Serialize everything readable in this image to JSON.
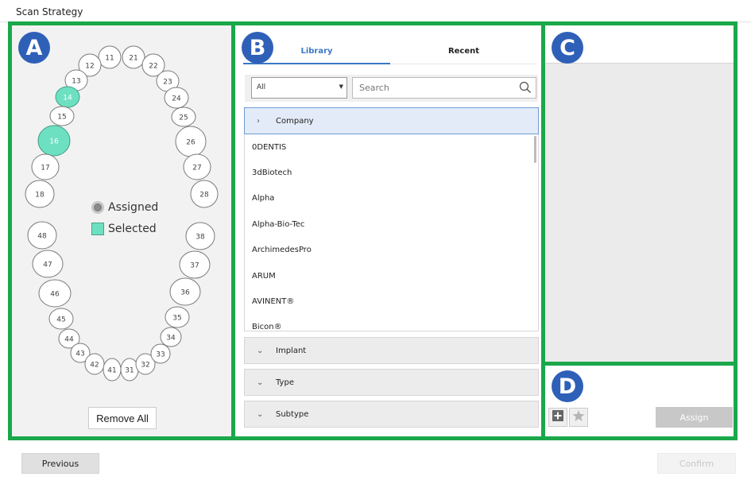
{
  "window": {
    "title": "Scan Strategy"
  },
  "badges": {
    "a": "A",
    "b": "B",
    "c": "C",
    "d": "D"
  },
  "colors": {
    "accent": "#3a78c8",
    "panel_border": "#1aa84a",
    "badge": "#2f60b8",
    "selected": "#6ee0c2",
    "assigned": "#8a8a8a"
  },
  "teeth": {
    "upper": [
      "11",
      "12",
      "13",
      "14",
      "15",
      "16",
      "17",
      "18",
      "21",
      "22",
      "23",
      "24",
      "25",
      "26",
      "27",
      "28"
    ],
    "lower": [
      "48",
      "47",
      "46",
      "45",
      "44",
      "43",
      "42",
      "41",
      "31",
      "32",
      "33",
      "34",
      "35",
      "36",
      "37",
      "38"
    ],
    "selected": [
      "14",
      "16"
    ]
  },
  "legend": {
    "assigned": "Assigned",
    "selected": "Selected"
  },
  "panel_a": {
    "remove_all": "Remove All"
  },
  "library": {
    "tabs": [
      {
        "label": "Library",
        "active": true
      },
      {
        "label": "Recent",
        "active": false
      }
    ],
    "filter": {
      "selected": "All"
    },
    "search": {
      "placeholder": "Search",
      "value": ""
    },
    "company": {
      "label": "Company",
      "items": [
        "0DENTIS",
        "3dBiotech",
        "Alpha",
        "Alpha-Bio-Tec",
        "ArchimedesPro",
        "ARUM",
        "AVINENT®",
        "Bicon®"
      ]
    },
    "implant_label": "Implant",
    "type_label": "Type",
    "subtype_label": "Subtype"
  },
  "panel_d": {
    "assign": "Assign",
    "add_icon": "plus-square-icon",
    "favorite_icon": "star-icon"
  },
  "footer": {
    "previous": "Previous",
    "confirm": "Confirm"
  }
}
